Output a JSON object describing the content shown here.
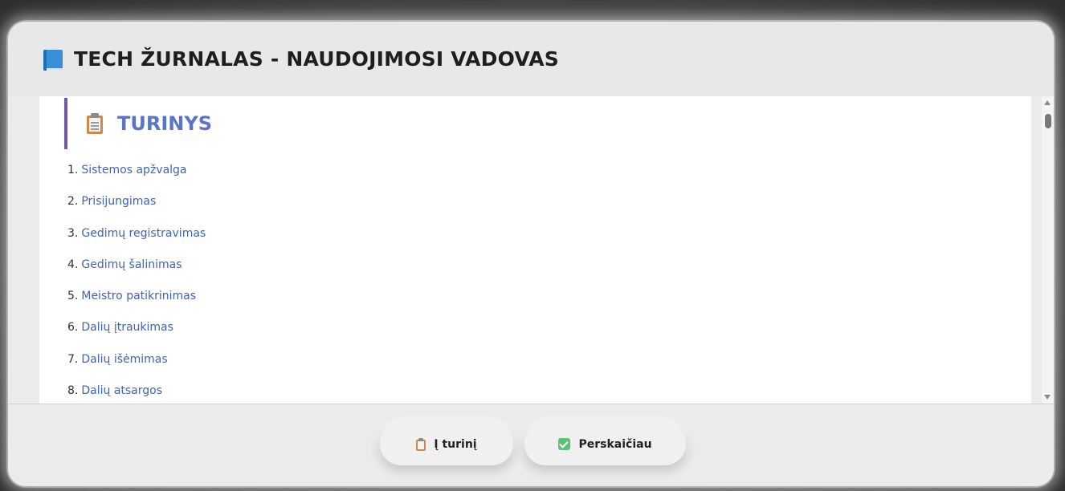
{
  "header": {
    "title": "TECH ŽURNALAS - NAUDOJIMOSI VADOVAS",
    "icon": "book-icon"
  },
  "content": {
    "section_title": "TURINYS",
    "section_icon": "clipboard-icon",
    "toc": [
      {
        "num": "1.",
        "label": "Sistemos apžvalga"
      },
      {
        "num": "2.",
        "label": "Prisijungimas"
      },
      {
        "num": "3.",
        "label": "Gedimų registravimas"
      },
      {
        "num": "4.",
        "label": "Gedimų šalinimas"
      },
      {
        "num": "5.",
        "label": "Meistro patikrinimas"
      },
      {
        "num": "6.",
        "label": "Dalių įtraukimas"
      },
      {
        "num": "7.",
        "label": "Dalių išėmimas"
      },
      {
        "num": "8.",
        "label": "Dalių atsargos"
      }
    ]
  },
  "footer": {
    "toc_button": "Į turinį",
    "read_button": "Perskaičiau"
  },
  "colors": {
    "accent_title": "#5a74c9",
    "link": "#3f63b8",
    "section_border": "#7358a8",
    "check": "#5cc275"
  }
}
